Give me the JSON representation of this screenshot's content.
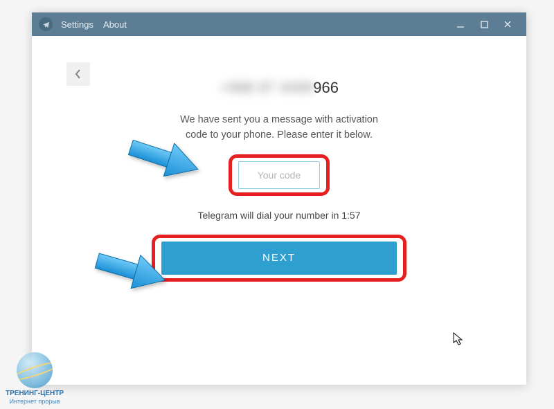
{
  "titlebar": {
    "menu_settings": "Settings",
    "menu_about": "About"
  },
  "page": {
    "phone_blurred": "+998 97 4499",
    "phone_visible": "966",
    "message_line1": "We have sent you a message with activation",
    "message_line2": "code to your phone. Please enter it below.",
    "code_placeholder": "Your code",
    "dial_message": "Telegram will dial your number in 1:57",
    "next_label": "NEXT"
  },
  "watermark": {
    "line1": "ТРЕНИНГ-ЦЕНТР",
    "line2": "Интернет прорыв"
  }
}
